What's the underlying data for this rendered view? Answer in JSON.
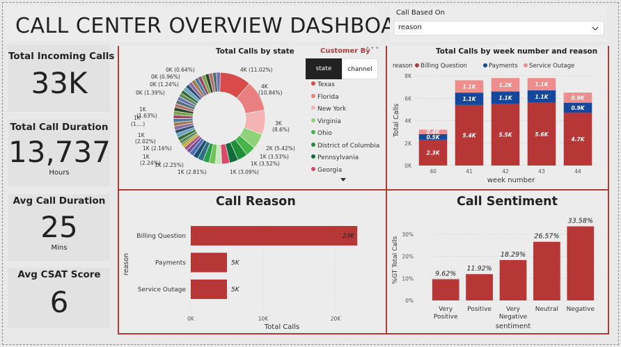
{
  "header": {
    "title": "CALL CENTER OVERVIEW DASHBOARD"
  },
  "slicer": {
    "label": "Call Based On",
    "value": "reason"
  },
  "kpis": [
    {
      "label": "Total Incoming Calls",
      "value": "33K",
      "unit": ""
    },
    {
      "label": "Total Call Duration",
      "value": "13,737",
      "unit": "Hours"
    },
    {
      "label": "Avg Call Duration",
      "value": "25",
      "unit": "Mins"
    },
    {
      "label": "Avg CSAT Score",
      "value": "6",
      "unit": ""
    }
  ],
  "customer_by": {
    "title": "Customer By",
    "tabs": [
      "state",
      "channel"
    ],
    "active_tab": "state",
    "legend": [
      {
        "name": "Texas",
        "color": "#d94a4a"
      },
      {
        "name": "Florida",
        "color": "#e97f7f"
      },
      {
        "name": "New York",
        "color": "#f4b4b4"
      },
      {
        "name": "Virginia",
        "color": "#8fd27a"
      },
      {
        "name": "Ohio",
        "color": "#45b54a"
      },
      {
        "name": "District of Columbia",
        "color": "#1f8f3a"
      },
      {
        "name": "Pennsylvania",
        "color": "#126b3a"
      },
      {
        "name": "Georgia",
        "color": "#d94a6a"
      }
    ]
  },
  "colors": {
    "accent": "#b23a3a",
    "billing": "#b73636",
    "payments": "#15489c",
    "outage": "#ee8d8d"
  },
  "chart_data": [
    {
      "id": "state",
      "type": "pie",
      "title": "Total Calls by state",
      "labels": [
        "4K (11.02%)",
        "4K (10.84%)",
        "3K (8.6%)",
        "2K (5.42%)",
        "1K (3.53%)",
        "1K (3.52%)",
        "1K (3.09%)",
        "1K (2.81%)",
        "1K (2.25%)",
        "1K (2.24%)",
        "1K (2.16%)",
        "1K (2.02%)",
        "1K (1....)",
        "1K (1.63%)",
        "0K (1.39%)",
        "0K (1.24%)",
        "0K (0.96%)",
        "0K (0.64%)"
      ],
      "named_slices": [
        {
          "name": "Texas",
          "value": 11.02,
          "color": "#d94a4a"
        },
        {
          "name": "Florida",
          "value": 10.84,
          "color": "#e97f7f"
        },
        {
          "name": "New York",
          "value": 8.6,
          "color": "#f4b4b4"
        },
        {
          "name": "Virginia",
          "value": 5.42,
          "color": "#8fd27a"
        },
        {
          "name": "Ohio",
          "value": 3.53,
          "color": "#45b54a"
        },
        {
          "name": "District of Columbia",
          "value": 3.52,
          "color": "#1f8f3a"
        },
        {
          "name": "Pennsylvania",
          "value": 3.09,
          "color": "#126b3a"
        },
        {
          "name": "Georgia",
          "value": 2.81,
          "color": "#d94a6a"
        }
      ],
      "other_values": [
        2.25,
        2.24,
        2.16,
        2.02,
        1.8,
        1.63,
        1.39,
        1.24,
        0.96,
        0.64
      ]
    },
    {
      "id": "week",
      "type": "bar",
      "stacked": true,
      "title": "Total Calls by week number and reason",
      "legend_title": "reason",
      "categories": [
        "40",
        "41",
        "42",
        "43",
        "44"
      ],
      "series": [
        {
          "name": "Billing Question",
          "values": [
            2.3,
            5.4,
            5.5,
            5.6,
            4.7
          ],
          "labels": [
            "2.3K",
            "5.4K",
            "5.5K",
            "5.6K",
            "4.7K"
          ]
        },
        {
          "name": "Payments",
          "values": [
            0.5,
            1.1,
            1.1,
            1.1,
            0.9
          ],
          "labels": [
            "0.5K",
            "1.1K",
            "1.1K",
            "1.1K",
            "0.9K"
          ]
        },
        {
          "name": "Service Outage",
          "values": [
            0.4,
            1.1,
            1.2,
            1.1,
            0.9
          ],
          "labels": [
            "0.4K",
            "1.1K",
            "1.2K",
            "1.1K",
            "0.9K"
          ]
        }
      ],
      "xlabel": "week number",
      "ylabel": "Total Calls",
      "yticks": [
        "0K",
        "2K",
        "4K",
        "6K",
        "8K"
      ],
      "ylim": [
        0,
        8
      ]
    },
    {
      "id": "reason",
      "type": "bar",
      "orientation": "horizontal",
      "title": "Call Reason",
      "categories": [
        "Billing Question",
        "Payments",
        "Service Outage"
      ],
      "values": [
        23,
        5,
        5
      ],
      "labels": [
        "23K",
        "5K",
        "5K"
      ],
      "xlabel": "Total Calls",
      "ylabel": "reason",
      "xticks": [
        "0K",
        "10K",
        "20K"
      ],
      "xlim": [
        0,
        25
      ]
    },
    {
      "id": "sentiment",
      "type": "bar",
      "title": "Call Sentiment",
      "categories": [
        "Very Positive",
        "Positive",
        "Very Negative",
        "Neutral",
        "Negative"
      ],
      "values": [
        9.62,
        11.92,
        18.29,
        26.57,
        33.58
      ],
      "labels": [
        "9.62%",
        "11.92%",
        "18.29%",
        "26.57%",
        "33.58%"
      ],
      "xlabel": "sentiment",
      "ylabel": "%GT Total Calls",
      "yticks": [
        "0%",
        "10%",
        "20%",
        "30%"
      ],
      "ylim": [
        0,
        35
      ]
    }
  ]
}
